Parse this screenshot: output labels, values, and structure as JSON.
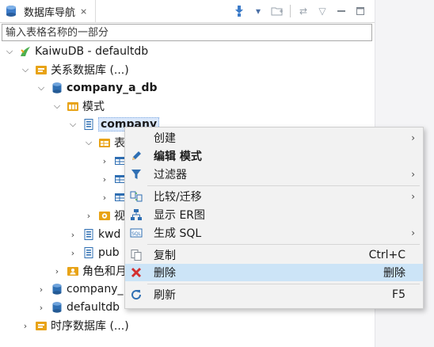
{
  "tab": {
    "title": "数据库导航",
    "close": "⨯"
  },
  "filter": {
    "placeholder": "输入表格名称的一部分",
    "value": ""
  },
  "tree": {
    "connection": "KaiwuDB - defaultdb",
    "relational": "关系数据库 (...)",
    "db_a": "company_a_db",
    "schemas": "模式",
    "company": "company",
    "tables_partial": "表",
    "views_partial": "视",
    "kwd_partial": "kwd",
    "pub_partial": "pub",
    "roles_partial": "角色和月",
    "company_partial": "company_",
    "defaultdb": "defaultdb",
    "timeseries": "时序数据库 (...)"
  },
  "menu": {
    "create": "创建",
    "edit_schema": "编辑 模式",
    "filter": "过滤器",
    "compare": "比较/迁移",
    "show_er": "显示 ER图",
    "gen_sql": "生成 SQL",
    "copy": "复制",
    "copy_shortcut": "Ctrl+C",
    "delete": "删除",
    "delete_shortcut": "删除",
    "refresh": "刷新",
    "refresh_shortcut": "F5"
  },
  "colors": {
    "accent": "#cce4f7",
    "db_yellow": "#e8a317",
    "table_blue": "#2f6fb3",
    "delete_red": "#d32f2f"
  }
}
